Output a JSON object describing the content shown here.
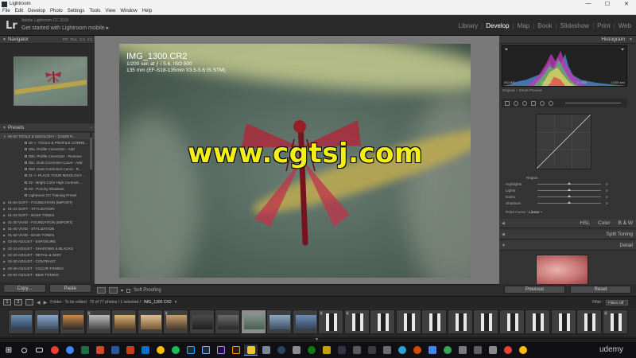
{
  "window": {
    "title": "Lightroom",
    "controls": [
      "—",
      "☐",
      "✕"
    ],
    "menu": [
      "File",
      "Edit",
      "Develop",
      "Photo",
      "Settings",
      "Tools",
      "View",
      "Window",
      "Help"
    ]
  },
  "header": {
    "logo": "Lr",
    "app_name": "Adobe Lightroom CC 2015",
    "mobile_label": "Get started with Lightroom mobile",
    "mobile_arrow": "▸",
    "modules": [
      "Library",
      "Develop",
      "Map",
      "Book",
      "Slideshow",
      "Print",
      "Web"
    ],
    "active_module": "Develop"
  },
  "navigator": {
    "title": "Navigator",
    "options": [
      "FIT",
      "FILL",
      "1:1",
      "1:1"
    ]
  },
  "presets": {
    "title": "Presets",
    "add": "+",
    "items": [
      {
        "label": "00-00 TOOLS & MIXOLOGY - (USER R...",
        "level": 0,
        "open": true
      },
      {
        "label": "00 <- TOOLS & PROFILE CORRE...",
        "level": 1
      },
      {
        "label": "00a. Profile Correction - Add",
        "level": 1
      },
      {
        "label": "00b. Profile Correction - Remove",
        "level": 1
      },
      {
        "label": "00c. Dust Correction Curve - Add",
        "level": 1
      },
      {
        "label": "00d. Dust Correction Curve - R...",
        "level": 1
      },
      {
        "label": "01 <- PLACE YOUR MIXOLOGY ...",
        "level": 1
      },
      {
        "label": "02 - Bright Color High Contrast ...",
        "level": 1
      },
      {
        "label": "03 - Punchy Shadows",
        "level": 1
      },
      {
        "label": "Lightroom CC Training Preset",
        "level": 1
      },
      {
        "label": "01-00 SOFT - FOUNDATION (IMPORT)",
        "level": 0
      },
      {
        "label": "01-10 SOFT - STYLIZATION",
        "level": 0
      },
      {
        "label": "01-20 SOFT - BASE TONES",
        "level": 0
      },
      {
        "label": "01-30 VIVID - FOUNDATION (IMPORT)",
        "level": 0
      },
      {
        "label": "01-40 VIVID - STYLIZATION",
        "level": 0
      },
      {
        "label": "01-50 VIVID - BASE TONES",
        "level": 0
      },
      {
        "label": "02-00 ADJUST - EXPOSURE",
        "level": 0
      },
      {
        "label": "02-10 ADJUST - SHADOWS & BLACKS",
        "level": 0
      },
      {
        "label": "02-20 ADJUST - DETAIL & SKIN",
        "level": 0
      },
      {
        "label": "02-30 ADJUST - CONTRAST",
        "level": 0
      },
      {
        "label": "02-40 ADJUST - COLOR TONING",
        "level": 0
      },
      {
        "label": "02-50 ADJUST - B&W TONING",
        "level": 0
      }
    ]
  },
  "left_buttons": {
    "copy": "Copy...",
    "paste": "Paste"
  },
  "photo": {
    "filename": "IMG_1300.CR2",
    "exposure_line": "1/200 sec at ƒ / 5.6, ISO 800",
    "lens_line": "135 mm (EF-S18-135mm f/3.5-5.6 IS STM)",
    "watermark": "www.cgtsj.com"
  },
  "toolbar": {
    "soft_proofing": "Soft Proofing"
  },
  "histogram": {
    "title": "Histogram",
    "meta": [
      "ISO 800",
      "135 mm",
      "ƒ / 5.6",
      "1/200 sec"
    ],
    "original_label": "Original + Smart Preview"
  },
  "tone_curve": {
    "region_title": "Region",
    "rows": [
      {
        "label": "Highlights",
        "value": "0"
      },
      {
        "label": "Lights",
        "value": "0"
      },
      {
        "label": "Darks",
        "value": "0"
      },
      {
        "label": "Shadows",
        "value": "0"
      }
    ],
    "point_curve_label": "Point Curve :",
    "point_curve_value": "Linear ÷"
  },
  "sections": {
    "hsl": "HSL",
    "color": "Color",
    "bw": "B & W",
    "split_toning": "Split Toning",
    "detail": "Detail"
  },
  "right_buttons": {
    "previous": "Previous",
    "reset": "Reset"
  },
  "filmbar": {
    "page1": "1",
    "page2": "2",
    "folder": "Folder : To be edited",
    "count": "70 of 77 photos / 1 selected /",
    "selected_file": "IMG_1300.CR2",
    "filter_label": "Filter :",
    "filter_value": "Filters Off"
  },
  "filmstrip": {
    "selected_index": 9,
    "badges": {
      "3": "3",
      "6": "2",
      "12": "3",
      "13": "3",
      "23": "3"
    }
  },
  "taskbar": {
    "watermark": "udemy"
  }
}
